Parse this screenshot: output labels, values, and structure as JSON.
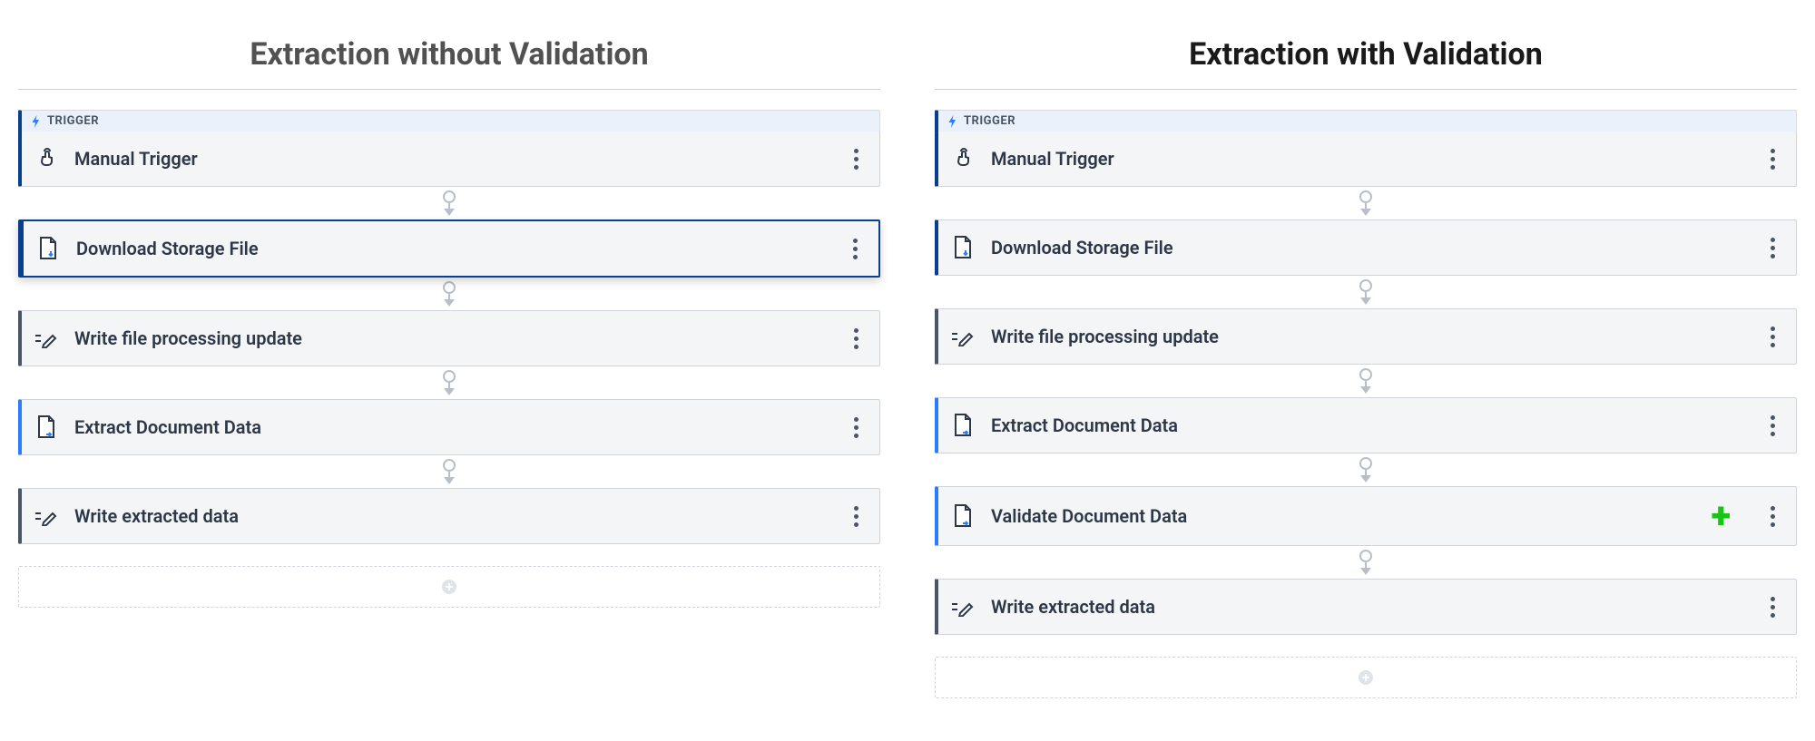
{
  "left": {
    "title": "Extraction without Validation",
    "trigger_label": "TRIGGER",
    "steps": [
      {
        "label": "Manual Trigger",
        "icon": "tap-icon",
        "accent": "darknavy",
        "trigger": true
      },
      {
        "label": "Download Storage File",
        "icon": "file-download-icon",
        "accent": "darknavy",
        "selected": true
      },
      {
        "label": "Write file processing update",
        "icon": "edit-lines-icon",
        "accent": "gray"
      },
      {
        "label": "Extract Document Data",
        "icon": "file-extract-icon",
        "accent": "blue"
      },
      {
        "label": "Write extracted data",
        "icon": "edit-lines-icon",
        "accent": "gray"
      }
    ]
  },
  "right": {
    "title": "Extraction with Validation",
    "trigger_label": "TRIGGER",
    "steps": [
      {
        "label": "Manual Trigger",
        "icon": "tap-icon",
        "accent": "darknavy",
        "trigger": true
      },
      {
        "label": "Download Storage File",
        "icon": "file-download-icon",
        "accent": "darknavy"
      },
      {
        "label": "Write file processing update",
        "icon": "edit-lines-icon",
        "accent": "gray"
      },
      {
        "label": "Extract Document Data",
        "icon": "file-extract-icon",
        "accent": "blue"
      },
      {
        "label": "Validate Document Data",
        "icon": "file-extract-icon",
        "accent": "blue",
        "badge": "plus"
      },
      {
        "label": "Write extracted data",
        "icon": "edit-lines-icon",
        "accent": "gray"
      }
    ]
  }
}
